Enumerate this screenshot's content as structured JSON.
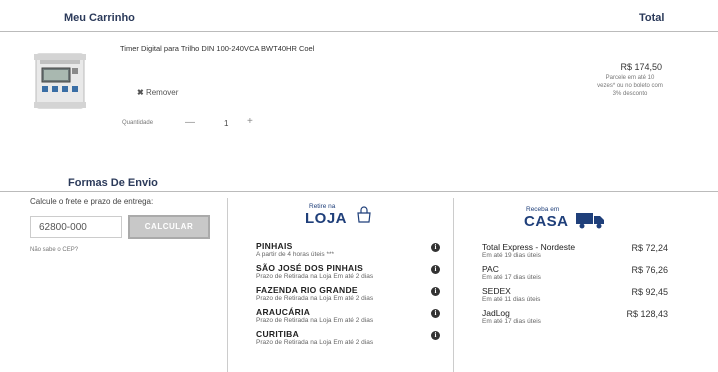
{
  "cart": {
    "title": "Meu Carrinho",
    "total_label": "Total",
    "item": {
      "name": "Timer Digital para Trilho DIN 100-240VCA BWT40HR Coel",
      "remove_label": "Remover",
      "quantity_label": "Quantidade",
      "quantity_minus": "—",
      "quantity_value": "1",
      "quantity_plus": "+",
      "price": "R$ 174,50",
      "installments": "Parcele em até 10 vezes* ou no boleto com 3% desconto"
    }
  },
  "shipping": {
    "title": "Formas De Envio",
    "calc_prompt": "Calcule o frete e prazo de entrega:",
    "cep_value": "62800-000",
    "calc_button": "CALCULAR",
    "cep_help": "Não sabe o CEP?"
  },
  "pickup": {
    "logo_small": "Retire na",
    "logo_big": "LOJA",
    "stores": [
      {
        "name": "PINHAIS",
        "detail": "A partir de 4 horas úteis ***"
      },
      {
        "name": "SÃO JOSÉ DOS PINHAIS",
        "detail": "Prazo de Retirada na Loja  Em até 2 dias"
      },
      {
        "name": "FAZENDA RIO GRANDE",
        "detail": "Prazo de Retirada na Loja  Em até 2 dias"
      },
      {
        "name": "ARAUCÁRIA",
        "detail": "Prazo de Retirada na Loja  Em até 2 dias"
      },
      {
        "name": "CURITIBA",
        "detail": "Prazo de Retirada na Loja  Em até 2 dias"
      }
    ]
  },
  "delivery": {
    "logo_small": "Receba em",
    "logo_big": "CASA",
    "options": [
      {
        "name": "Total Express - Nordeste",
        "detail": "Em até 19 dias úteis",
        "price": "R$ 72,24"
      },
      {
        "name": "PAC",
        "detail": "Em até 17 dias úteis",
        "price": "R$ 76,26"
      },
      {
        "name": "SEDEX",
        "detail": "Em até 11 dias úteis",
        "price": "R$ 92,45"
      },
      {
        "name": "JadLog",
        "detail": "Em até 17 dias úteis",
        "price": "R$ 128,43"
      }
    ]
  },
  "colors": {
    "heading": "#2b3a5a",
    "logo": "#1f3f7a",
    "info_icon": "#333333"
  },
  "icons": {
    "remove": "x-icon",
    "info": "info-icon",
    "store": "store-icon",
    "truck": "truck-icon"
  }
}
